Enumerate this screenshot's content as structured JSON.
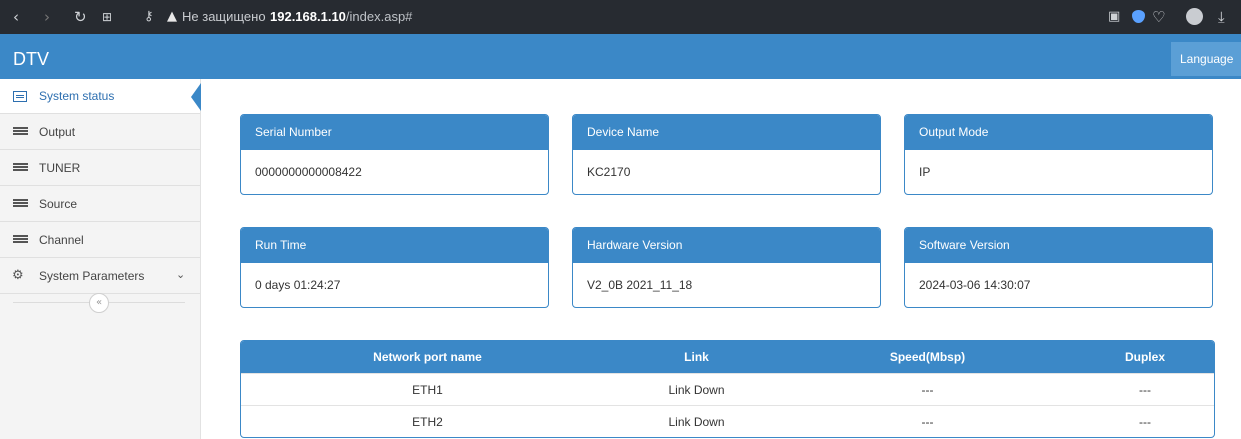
{
  "browser": {
    "warning": "Не защищено",
    "host": "192.168.1.10",
    "path": "/index.asp#"
  },
  "app": {
    "brand": "DTV",
    "language_label": "Language"
  },
  "sidebar": {
    "items": [
      {
        "label": "System status",
        "icon": "monitor-icon",
        "active": true
      },
      {
        "label": "Output",
        "icon": "menu-icon"
      },
      {
        "label": "TUNER",
        "icon": "menu-icon"
      },
      {
        "label": "Source",
        "icon": "menu-icon"
      },
      {
        "label": "Channel",
        "icon": "menu-icon"
      },
      {
        "label": "System Parameters",
        "icon": "gears-icon"
      }
    ]
  },
  "cards": [
    {
      "title": "Serial Number",
      "value": "0000000000008422"
    },
    {
      "title": "Device Name",
      "value": "KC2170"
    },
    {
      "title": "Output Mode",
      "value": "IP"
    },
    {
      "title": "Run Time",
      "value": "0 days 01:24:27"
    },
    {
      "title": "Hardware Version",
      "value": "V2_0B 2021_11_18"
    },
    {
      "title": "Software Version",
      "value": "2024-03-06 14:30:07"
    }
  ],
  "network": {
    "headers": [
      "Network port name",
      "Link",
      "Speed(Mbsp)",
      "Duplex"
    ],
    "rows": [
      [
        "ETH1",
        "Link Down",
        "---",
        "---"
      ],
      [
        "ETH2",
        "Link Down",
        "---",
        "---"
      ]
    ]
  },
  "colors": {
    "primary": "#3b88c7",
    "language_bg": "#5b9fd6",
    "browser_bg": "#272b31"
  }
}
